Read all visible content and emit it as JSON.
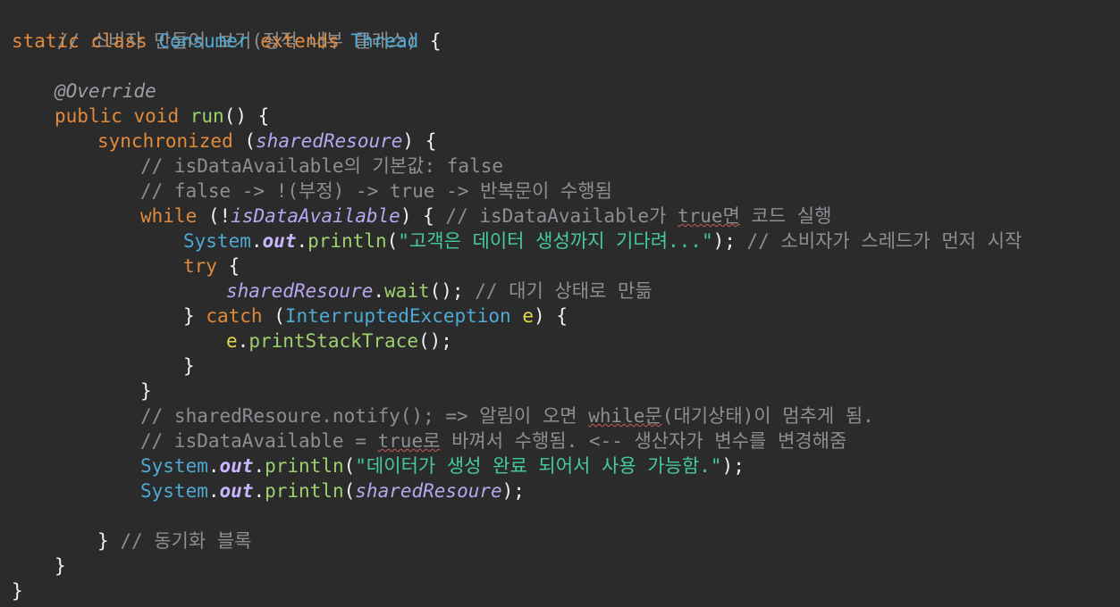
{
  "code": {
    "l1": {
      "comment": "// 소비자 만들어 보기(정적 내부 클래스)"
    },
    "l2": {
      "kw_static": "static",
      "kw_class": "class",
      "class_name": "Consumer",
      "kw_extends": "extends",
      "super_name": "Thread",
      "brace": "{"
    },
    "l4": {
      "annotation": "@Override"
    },
    "l5": {
      "kw_public": "public",
      "kw_void": "void",
      "method": "run",
      "tail": "() {"
    },
    "l6": {
      "kw": "synchronized",
      "open": "(",
      "field": "sharedResoure",
      "tail": ") {"
    },
    "l7": {
      "comment": "// isDataAvailable의 기본값: false"
    },
    "l8": {
      "comment": "// false -> !(부정) -> true -> 반복문이 수행됨"
    },
    "l9": {
      "kw": "while",
      "open": "(!",
      "field": "isDataAvailable",
      "mid": ") {",
      "comment_a": "// isDataAvailable가 ",
      "comment_b": "true면",
      "comment_c": " 코드 실행"
    },
    "l10": {
      "type": "System",
      "dot1": ".",
      "sfield": "out",
      "dot2": ".",
      "method": "println",
      "open": "(",
      "string": "\"고객은 데이터 생성까지 기다려...\"",
      "close": ");",
      "comment": "// 소비자가 스레드가 먼저 시작"
    },
    "l11": {
      "kw": "try",
      "brace": "{"
    },
    "l12": {
      "field": "sharedResoure",
      "dot": ".",
      "method": "wait",
      "tail": "();",
      "comment": "// 대기 상태로 만듦"
    },
    "l13": {
      "close_brace": "}",
      "kw": "catch",
      "open": "(",
      "type": "InterruptedException",
      "var": "e",
      "tail": ") {"
    },
    "l14": {
      "obj": "e",
      "dot": ".",
      "method": "printStackTrace",
      "tail": "();"
    },
    "l15": {
      "brace": "}"
    },
    "l16": {
      "brace": "}"
    },
    "l17": {
      "comment_a": "// sharedResoure.notify(); => 알림이 오면 ",
      "comment_b": "while문",
      "comment_c": "(대기상태)이 멈추게 됨."
    },
    "l18": {
      "comment_a": "// isDataAvailable = ",
      "comment_b": "true로",
      "comment_c": " 바껴서 수행됨. <-- 생산자가 변수를 변경해줌"
    },
    "l19": {
      "type": "System",
      "dot1": ".",
      "sfield": "out",
      "dot2": ".",
      "method": "println",
      "open": "(",
      "string": "\"데이터가 생성 완료 되어서 사용 가능함.\"",
      "close": ");"
    },
    "l20": {
      "type": "System",
      "dot1": ".",
      "sfield": "out",
      "dot2": ".",
      "method": "println",
      "open": "(",
      "field": "sharedResoure",
      "close": ");"
    },
    "l22": {
      "brace": "}",
      "comment": "// 동기화 블록"
    },
    "l23": {
      "brace": "}"
    },
    "l24": {
      "brace": "}"
    }
  },
  "colors": {
    "background": "#2b2b2b",
    "comment": "#8b8f93",
    "keyword": "#e08a3c",
    "type": "#4ea9d4",
    "method": "#9ed06e",
    "string": "#44c9a0",
    "field": "#b8a6ef",
    "squiggle": "#c85a5a"
  }
}
